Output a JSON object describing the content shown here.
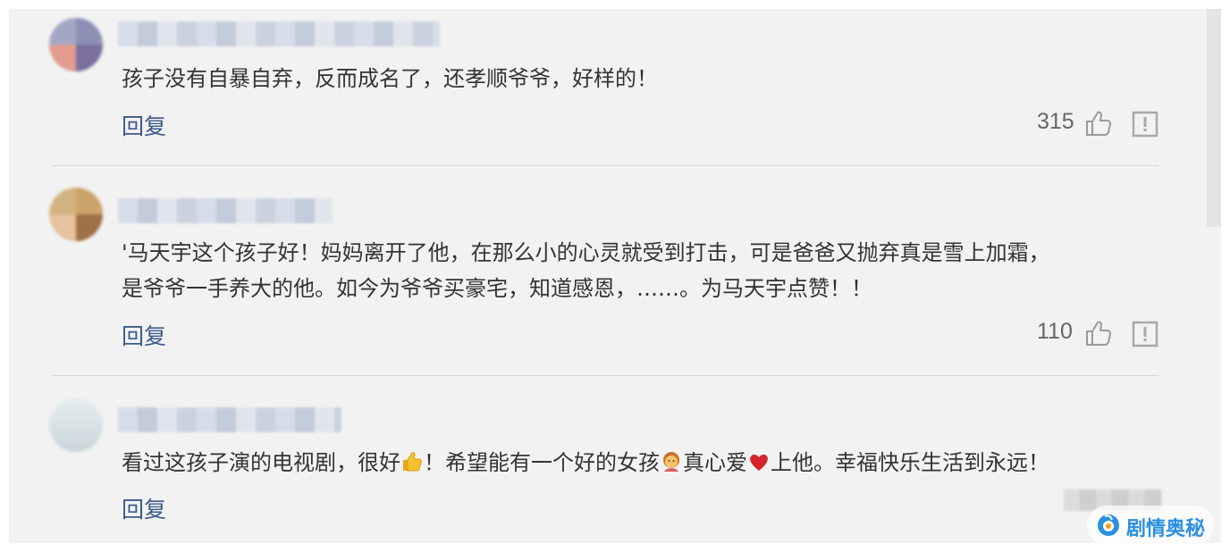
{
  "comments": [
    {
      "text": "孩子没有自暴自弃，反而成名了，还孝顺爷爷，好样的！",
      "reply_label": "回复",
      "likes": "315"
    },
    {
      "text": "'马天宇这个孩子好！妈妈离开了他，在那么小的心灵就受到打击，可是爸爸又抛弃真是雪上加霜，\n是爷爷一手养大的他。如今为爷爷买豪宅，知道感恩，……。为马天宇点赞！！",
      "reply_label": "回复",
      "likes": "110"
    },
    {
      "text_part1": "看过这孩子演的电视剧，很好",
      "text_part2": "！希望能有一个好的女孩",
      "text_part3": "真心爱",
      "text_part4": "上他。幸福快乐生活到永远！",
      "emojis": [
        "thumbs-up-emoji",
        "girl-emoji",
        "red-heart-emoji"
      ],
      "reply_label": "回复"
    }
  ],
  "watermark": {
    "label": "剧情奥秘"
  },
  "colors": {
    "background": "#f2f2f2",
    "text": "#333333",
    "reply": "#3d5a8a",
    "likes": "#666666",
    "watermark": "#2a90e0"
  },
  "icons": [
    "thumbs-up-icon",
    "report-icon",
    "watermark-logo-icon"
  ]
}
